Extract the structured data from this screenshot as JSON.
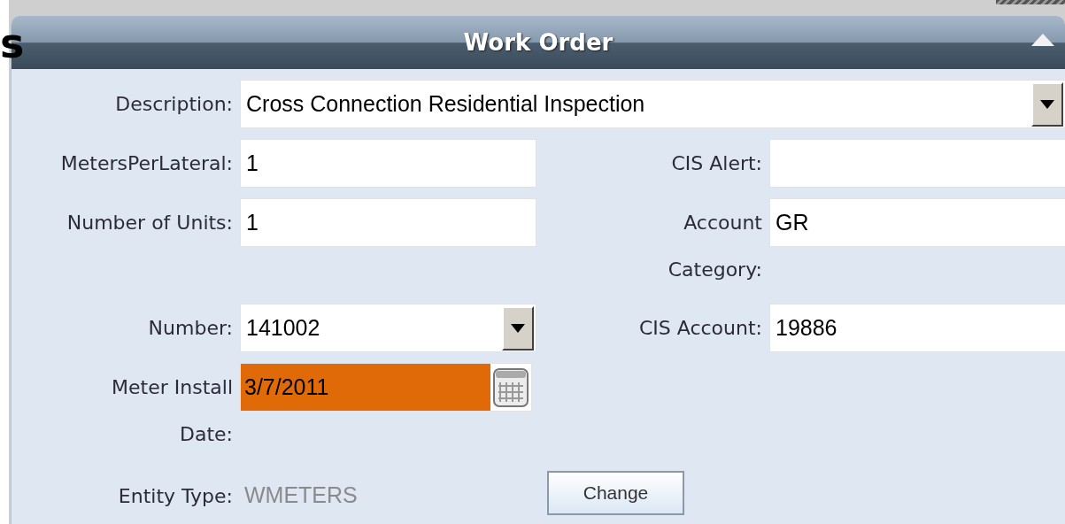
{
  "background_text": "s",
  "panel": {
    "title": "Work Order"
  },
  "description": {
    "label": "Description:",
    "value": "Cross Connection Residential Inspection"
  },
  "meters_per_lateral": {
    "label": "MetersPerLateral:",
    "value": "1"
  },
  "cis_alert": {
    "label": "CIS Alert:"
  },
  "number_of_units": {
    "label": "Number of Units:",
    "value": "1"
  },
  "account_category": {
    "label": "Account Category:",
    "value": "GR"
  },
  "number": {
    "label": "Number:",
    "value": "141002"
  },
  "cis_account": {
    "label": "CIS Account:",
    "value": "19886"
  },
  "meter_install_date": {
    "label": "Meter Install Date:",
    "value": "3/7/2011",
    "highlighted": true
  },
  "entity_type": {
    "label": "Entity Type:",
    "value": "WMETERS"
  },
  "change_button": "Change"
}
